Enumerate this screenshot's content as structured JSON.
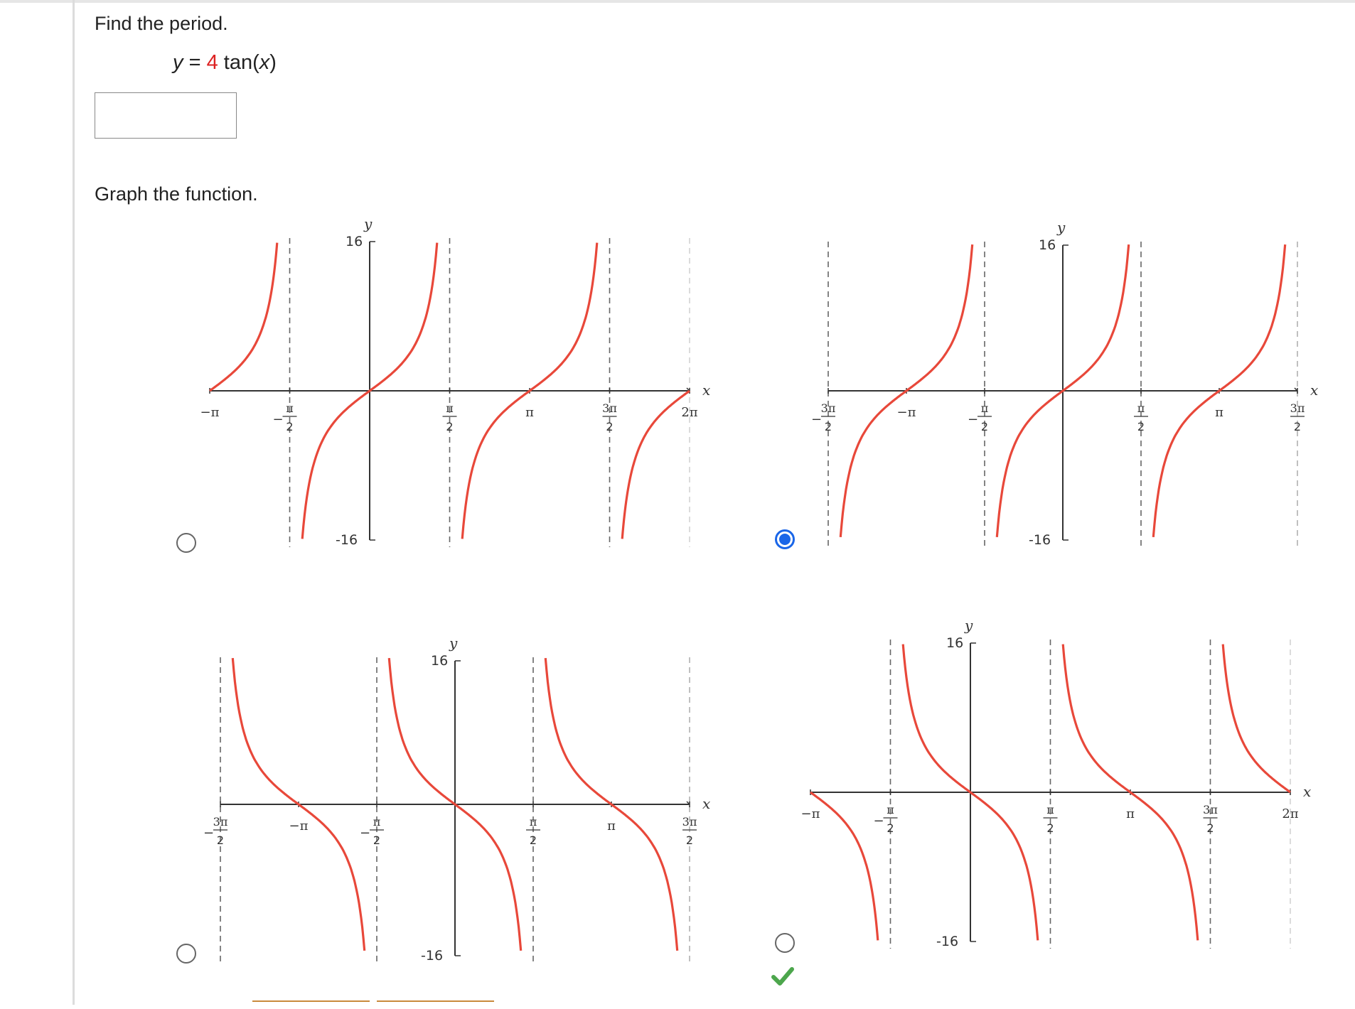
{
  "question": {
    "find_period": "Find the period.",
    "equation": {
      "lhs": "y",
      "equals": "=",
      "coef": "4",
      "func": "tan(",
      "var": "x",
      "close": ")"
    },
    "answer_value": "",
    "graph_instruction": "Graph the function."
  },
  "options": [
    {
      "id": "A",
      "selected": false,
      "direction": "increasing",
      "x_ticks": [
        "-π",
        "-π/2",
        "π/2",
        "π",
        "3π/2",
        "2π"
      ],
      "y_top": "16",
      "y_bottom": "-16",
      "x_label": "x",
      "y_label": "y"
    },
    {
      "id": "B",
      "selected": true,
      "direction": "increasing",
      "x_ticks": [
        "-3π/2",
        "-π",
        "-π/2",
        "π/2",
        "π",
        "3π/2"
      ],
      "y_top": "16",
      "y_bottom": "-16",
      "x_label": "x",
      "y_label": "y"
    },
    {
      "id": "C",
      "selected": false,
      "direction": "decreasing",
      "x_ticks": [
        "-3π/2",
        "-π",
        "-π/2",
        "π/2",
        "π",
        "3π/2"
      ],
      "y_top": "16",
      "y_bottom": "-16",
      "x_label": "x",
      "y_label": "y"
    },
    {
      "id": "D",
      "selected": false,
      "direction": "decreasing",
      "x_ticks": [
        "-π",
        "-π/2",
        "π/2",
        "π",
        "3π/2",
        "2π"
      ],
      "y_top": "16",
      "y_bottom": "-16",
      "x_label": "x",
      "y_label": "y"
    }
  ],
  "feedback": {
    "icon": "check-icon",
    "color": "#4ca64c"
  },
  "colors": {
    "curve": "#e8483a",
    "accent": "#1a66e8",
    "axis": "#333333",
    "asymptote": "#666666"
  }
}
